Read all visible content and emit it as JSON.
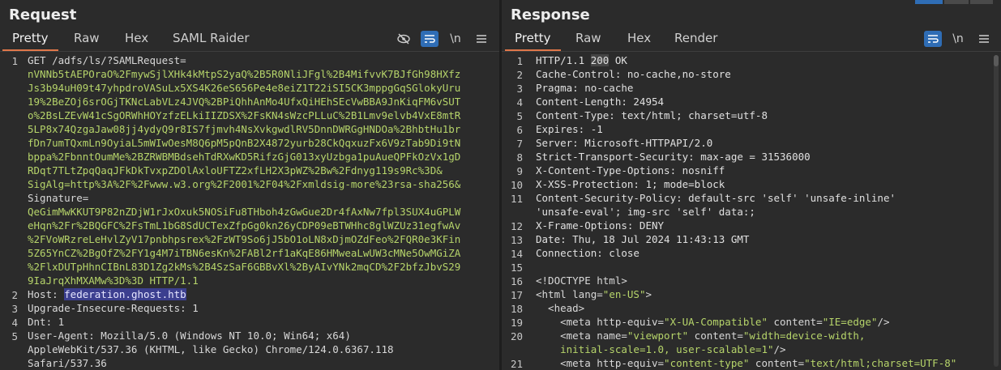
{
  "request": {
    "title": "Request",
    "tabs": [
      "Pretty",
      "Raw",
      "Hex",
      "SAML Raider"
    ],
    "active_tab": "Pretty",
    "toolbar": {
      "hide_icon": "eye-slash-icon",
      "wrap_icon": "wrap-icon",
      "newline_label": "\\n",
      "menu_icon": "hamburger-icon"
    },
    "line_numbers": [
      "1",
      "2",
      "3",
      "4",
      "5"
    ],
    "lines": [
      [
        "GET /adfs/ls/?SAMLRequest="
      ],
      [
        "nVNNb5tAEPOraO%2FmywSjlXHk4kMtpS2yaQ%2B5R0NliJFgl%2B4MifvvK7BJfGh98HXfz"
      ],
      [
        "Js3b94uH09t47yhpdroVASuLx5XS4K26eS656Pe4e8eiZ1T22iSI5CK3mppgGqSGlokyUru"
      ],
      [
        "19%2BeZOj6srOGjTKNcLabVLz4JVQ%2BPiQhhAnMo4UfxQiHEhSEcVwBBA9JnKiqFM6vSUT"
      ],
      [
        "o%2BsLZEvW41cSgORWhHOYzfzELkiIIZDSX%2FsKN4sWzcPLLuC%2B1Lmv9elvb4VxE8mtR"
      ],
      [
        "5LP8x74QzgaJaw08jj4ydyQ9r8IS7fjmvh4NsXvkgwdlRV5DnnDWRGgHNDOa%2BhbtHu1br"
      ],
      [
        "fDn7umTQxmLn9OyiaL5mWIwOesM8Q6pM5pQnB2X4872yurb28CkQqxuzFx6V9zTab9Di9tN"
      ],
      [
        "bppa%2FbnntOumMe%2BZRWBMBdsehTdRXwKD5RifzGjG013xyUzbga1puAueQPFkOzVx1gD"
      ],
      [
        "RDqt7TLtZpqQaqJFkDkTvxpZDOlAxloUFTZ2xfLH2X3pWZ%2Bw%2Fdnyg119s9Rc%3D&"
      ],
      [
        "SigAlg=http%3A%2F%2Fwww.w3.org%2F2001%2F04%2Fxmldsig-more%23rsa-sha256&"
      ],
      [
        "Signature="
      ],
      [
        "QeGimMwKKUT9P82nZDjW1rJxOxuk5NOSiFu8THboh4zGwGue2Dr4fAxNw7fpl3SUX4uGPLW"
      ],
      [
        "eHqn%2Fr%2BQGFC%2FsTmL1bG8SdUCTexZfpGg0kn26yCDP09eBTWHhc8glWZUz31egfwAv"
      ],
      [
        "%2FVoWRzreLeHvlZyV17pnbhpsrex%2FzWT9So6jJ5bO1oLN8xDjmOZdFeo%2FQR0e3KFin"
      ],
      [
        "5Z65YnCZ%2BgOfZ%2FY1g4M7iTBN6esKn%2FABl2rf1aKqE86HMweaLwUW3cMNe5OwMGiZA"
      ],
      [
        "%2FlxDUTpHhnCIBnL83D1Zg2kMs%2B4SzSaF6GBBvXl%2ByAIvYNk2mqCD%2F2bfzJbvS29"
      ],
      [
        "9IaJrqXhMXAMw%3D%3D HTTP/1.1"
      ],
      [
        "Host: ",
        "federation.ghost.htb"
      ],
      [
        "Upgrade-Insecure-Requests: 1"
      ],
      [
        "Dnt: 1"
      ],
      [
        "User-Agent: Mozilla/5.0 (Windows NT 10.0; Win64; x64)"
      ],
      [
        "AppleWebKit/537.36 (KHTML, like Gecko) Chrome/124.0.6367.118"
      ],
      [
        "Safari/537.36"
      ]
    ]
  },
  "response": {
    "title": "Response",
    "tabs": [
      "Pretty",
      "Raw",
      "Hex",
      "Render"
    ],
    "active_tab": "Pretty",
    "toolbar": {
      "wrap_icon": "wrap-icon",
      "newline_label": "\\n",
      "menu_icon": "hamburger-icon"
    },
    "line_numbers": [
      "1",
      "2",
      "3",
      "4",
      "5",
      "6",
      "7",
      "8",
      "9",
      "10",
      "11",
      "",
      "12",
      "13",
      "14",
      "15",
      "16",
      "17",
      "18",
      "19",
      "20",
      "",
      "21"
    ],
    "lines": [
      [
        "HTTP/1.1 ",
        "200",
        " OK"
      ],
      [
        "Cache-Control: no-cache,no-store"
      ],
      [
        "Pragma: no-cache"
      ],
      [
        "Content-Length: 24954"
      ],
      [
        "Content-Type: text/html; charset=utf-8"
      ],
      [
        "Expires: -1"
      ],
      [
        "Server: Microsoft-HTTPAPI/2.0"
      ],
      [
        "Strict-Transport-Security: max-age = 31536000"
      ],
      [
        "X-Content-Type-Options: nosniff"
      ],
      [
        "X-XSS-Protection: 1; mode=block"
      ],
      [
        "Content-Security-Policy: default-src 'self' 'unsafe-inline'"
      ],
      [
        "'unsafe-eval'; img-src 'self' data:;"
      ],
      [
        "X-Frame-Options: DENY"
      ],
      [
        "Date: Thu, 18 Jul 2024 11:43:13 GMT"
      ],
      [
        "Connection: close"
      ],
      [
        ""
      ],
      [
        "<!DOCTYPE html>"
      ],
      [
        "<html lang=",
        "\"en-US\"",
        ">"
      ],
      [
        "  <head>"
      ],
      [
        "    <meta http-equiv=",
        "\"X-UA-Compatible\"",
        " content=",
        "\"IE=edge\"",
        "/>"
      ],
      [
        "    <meta name=",
        "\"viewport\"",
        " content=",
        "\"width=device-width,"
      ],
      [
        "    ",
        "initial-scale=1.0, user-scalable=1\"",
        "/>"
      ],
      [
        "    <meta http-equiv=",
        "\"content-type\"",
        " content=",
        "\"text/html;charset=UTF-8\""
      ]
    ]
  },
  "colors": {
    "accent": "#e0774a",
    "selected": "#2f6db5",
    "green_text": "#b6d46a"
  }
}
